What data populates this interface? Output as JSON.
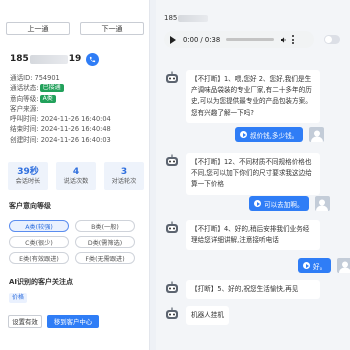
{
  "nav": {
    "prev_label": "上一通",
    "next_label": "下一通"
  },
  "customer": {
    "phone_prefix": "185",
    "phone_suffix": "19",
    "info": [
      {
        "label": "通话ID:",
        "value": "754901"
      },
      {
        "label": "通话状态:",
        "badge": "已接通"
      },
      {
        "label": "意向等级:",
        "badge": "A类"
      },
      {
        "label": "客户来源:",
        "value": ""
      },
      {
        "label": "呼叫时间:",
        "value": "2024-11-26 16:40:04"
      },
      {
        "label": "结束时间:",
        "value": "2024-11-26 16:40:48"
      },
      {
        "label": "创建时间:",
        "value": "2024-11-26 16:40:03"
      }
    ]
  },
  "stats": [
    {
      "value": "39秒",
      "label": "会话时长"
    },
    {
      "value": "4",
      "label": "说话次数"
    },
    {
      "value": "3",
      "label": "对话轮次"
    }
  ],
  "intent": {
    "title": "客户意向等级",
    "options": [
      "A类(较强)",
      "B类(一般)",
      "C类(很少)",
      "D类(需筛选)",
      "E类(有效跟进)",
      "F类(无需跟进)"
    ],
    "selected": "A类(较强)"
  },
  "focus": {
    "title": "AI识别的客户关注点",
    "tag": "价格"
  },
  "actions": {
    "set_valid": "设置有效",
    "move_to_center": "移到客户中心"
  },
  "player": {
    "phone_prefix": "185",
    "time": "0:00 / 0:38",
    "progress": 0
  },
  "chat": [
    {
      "side": "bot",
      "text": "【不打断】1、喂,您好 2、您好,我们是生产调味品袋装的专业厂家,有二十多年的历史,可以为您提供最专业的产品包装方案。您有兴趣了解一下吗?"
    },
    {
      "side": "user",
      "text": "叔价钱,多少钱。"
    },
    {
      "side": "bot",
      "text": "【不打断】12、不同材质不同规格价格也不同,您可以加下你们的尺寸要求我这边给算一下价格"
    },
    {
      "side": "user",
      "text": "可以去加啊。"
    },
    {
      "side": "bot",
      "text": "【不打断】4、好的,稍后安排我们业务经理给您详细讲解,注意接听电话"
    },
    {
      "side": "user",
      "text": "好。"
    },
    {
      "side": "bot",
      "text": "【打断】5、好的,祝您生活愉快,再见"
    },
    {
      "side": "bot",
      "text": "机器人挂机"
    }
  ],
  "colors": {
    "accent": "#2f7df6",
    "status_green": "#22a15b"
  }
}
